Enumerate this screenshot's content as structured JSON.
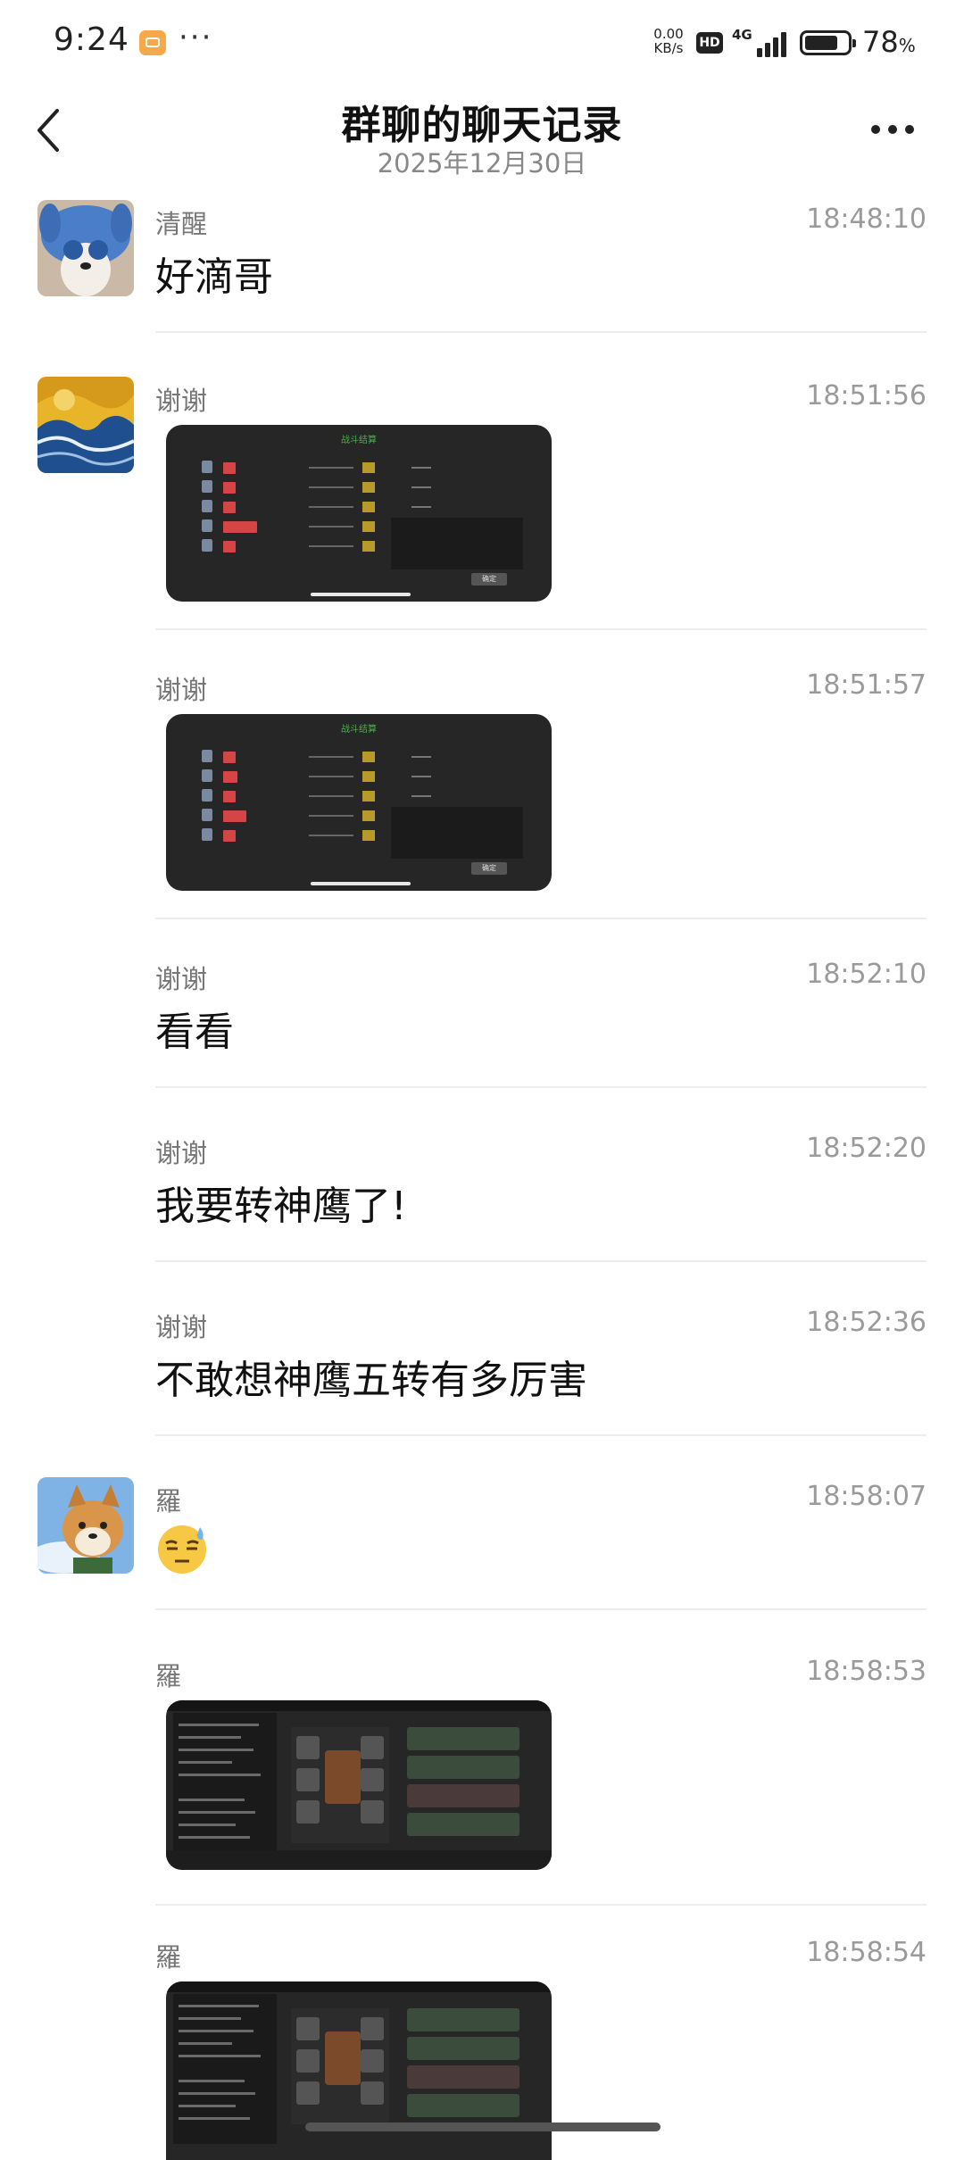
{
  "status_bar": {
    "time": "9:24",
    "notification_more": "···",
    "net_speed_value": "0.00",
    "net_speed_unit": "KB/s",
    "hd_badge": "HD",
    "network_type": "4G",
    "battery_level": 0.78,
    "battery_percent": "78",
    "percent_sign": "%"
  },
  "header": {
    "title": "群聊的聊天记录",
    "date": "2025年12月30日"
  },
  "messages": [
    {
      "sender": "清醒",
      "time": "18:48:10",
      "text": "好滴哥",
      "avatar": "stitch-dog-avatar"
    },
    {
      "sender": "谢谢",
      "time": "18:51:56",
      "image_header": "战斗结算",
      "image_button": "确定",
      "avatar": "starry-wave-avatar"
    },
    {
      "sender": "谢谢",
      "time": "18:51:57",
      "image_header": "战斗结算",
      "image_button": "确定"
    },
    {
      "sender": "谢谢",
      "time": "18:52:10",
      "text": "看看"
    },
    {
      "sender": "谢谢",
      "time": "18:52:20",
      "text": "我要转神鹰了!"
    },
    {
      "sender": "谢谢",
      "time": "18:52:36",
      "text": "不敢想神鹰五转有多厉害"
    },
    {
      "sender": "羅",
      "time": "18:58:07",
      "emoji": "sweat-smile-emoji",
      "avatar": "shiba-dog-avatar"
    },
    {
      "sender": "羅",
      "time": "18:58:53"
    },
    {
      "sender": "羅",
      "time": "18:58:54"
    }
  ]
}
